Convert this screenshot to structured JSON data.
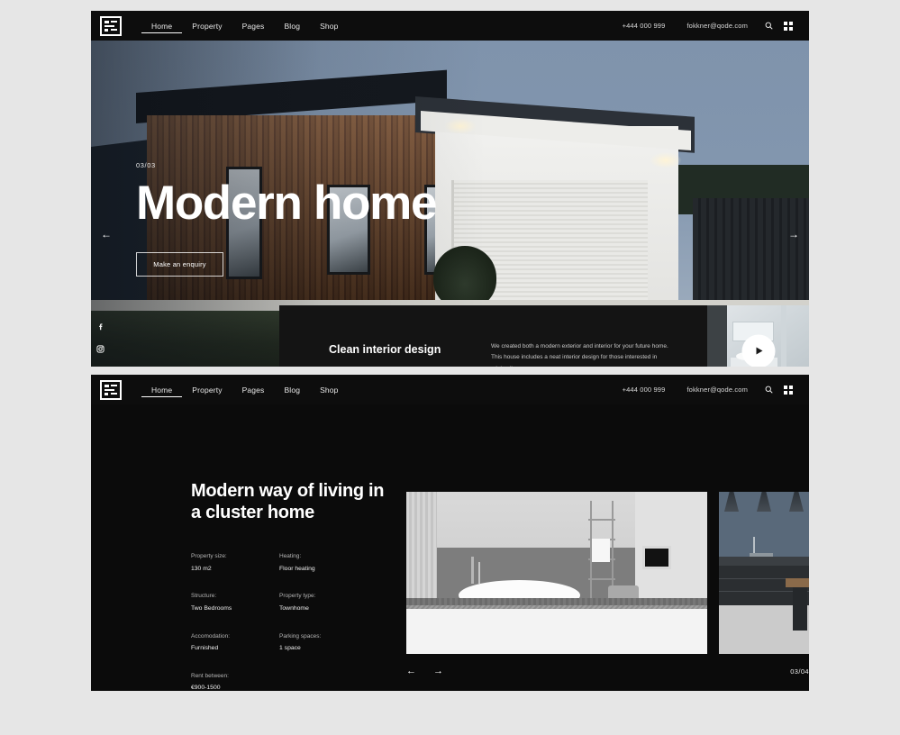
{
  "site_sections": [
    {
      "header": {
        "logo_name": "qode-logo",
        "nav": [
          {
            "label": "Home",
            "active": true
          },
          {
            "label": "Property",
            "active": false
          },
          {
            "label": "Pages",
            "active": false
          },
          {
            "label": "Blog",
            "active": false
          },
          {
            "label": "Shop",
            "active": false
          }
        ],
        "phone": "+444 000 999",
        "email": "fokkner@qode.com",
        "search_icon": "search-icon",
        "grid_icon": "grid-menu-icon"
      },
      "hero": {
        "slide_counter": "03/03",
        "title": "Modern home",
        "cta_label": "Make an enquiry",
        "prev_arrow": "←",
        "next_arrow": "→"
      },
      "social": [
        {
          "name": "facebook-icon"
        },
        {
          "name": "instagram-icon"
        },
        {
          "name": "twitter-icon"
        }
      ],
      "info_panel": {
        "title": "Clean interior design",
        "text": "We created both a modern exterior and interior for your future home. This house includes a neat interior design for those interested in minimalism.",
        "play_label": "play-button"
      }
    },
    {
      "header": {
        "logo_name": "qode-logo",
        "nav": [
          {
            "label": "Home",
            "active": true
          },
          {
            "label": "Property",
            "active": false
          },
          {
            "label": "Pages",
            "active": false
          },
          {
            "label": "Blog",
            "active": false
          },
          {
            "label": "Shop",
            "active": false
          }
        ],
        "phone": "+444 000 999",
        "email": "fokkner@qode.com",
        "search_icon": "search-icon",
        "grid_icon": "grid-menu-icon"
      },
      "gallery": {
        "title": "Modern way of living in a cluster home",
        "specs": [
          {
            "key": "Property size:",
            "value": "130 m2"
          },
          {
            "key": "Heating:",
            "value": "Floor heating"
          },
          {
            "key": "Structure:",
            "value": "Two Bedrooms"
          },
          {
            "key": "Property type:",
            "value": "Townhome"
          },
          {
            "key": "Accomodation:",
            "value": "Furnished"
          },
          {
            "key": "Parking spaces:",
            "value": "1 space"
          },
          {
            "key": "Rent between:",
            "value": "€900-1500"
          }
        ],
        "slide_counter": "03/04",
        "prev_arrow": "←",
        "next_arrow": "→"
      }
    }
  ],
  "colors": {
    "page_background": "#e6e6e6",
    "site_background": "#0b0b0b",
    "header_background": "#0d0d0d",
    "panel_background": "#141414",
    "text_primary": "#ffffff",
    "text_muted": "#b4b4b4",
    "sky": "#8296ae"
  }
}
